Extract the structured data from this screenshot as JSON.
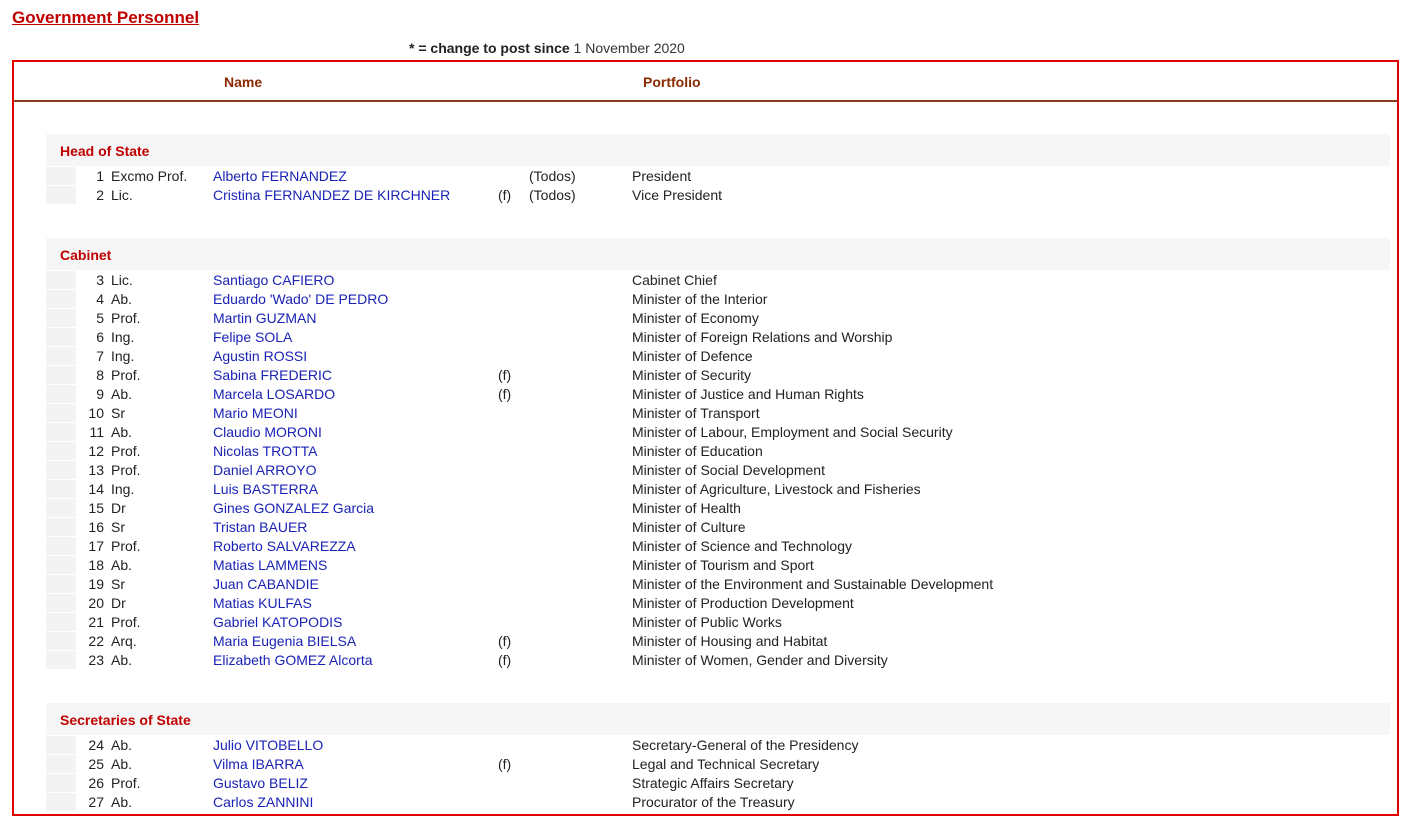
{
  "page": {
    "title": "Government Personnel",
    "legend_symbol": "* = change to post since",
    "legend_date": "1 November 2020"
  },
  "table": {
    "headers": {
      "name": "Name",
      "portfolio": "Portfolio"
    },
    "sections": [
      {
        "label": "Head of State",
        "rows": [
          {
            "num": "1",
            "title": "Excmo Prof.",
            "name": "Alberto FERNANDEZ",
            "female": "",
            "todos": "(Todos)",
            "post": "President"
          },
          {
            "num": "2",
            "title": "Lic.",
            "name": "Cristina FERNANDEZ DE KIRCHNER",
            "female": "(f)",
            "todos": "(Todos)",
            "post": "Vice President"
          }
        ]
      },
      {
        "label": "Cabinet",
        "rows": [
          {
            "num": "3",
            "title": "Lic.",
            "name": "Santiago CAFIERO",
            "female": "",
            "todos": "",
            "post": "Cabinet Chief"
          },
          {
            "num": "4",
            "title": "Ab.",
            "name": "Eduardo 'Wado' DE PEDRO",
            "female": "",
            "todos": "",
            "post": "Minister of the Interior"
          },
          {
            "num": "5",
            "title": "Prof.",
            "name": "Martin GUZMAN",
            "female": "",
            "todos": "",
            "post": "Minister of Economy"
          },
          {
            "num": "6",
            "title": "Ing.",
            "name": "Felipe SOLA",
            "female": "",
            "todos": "",
            "post": "Minister of Foreign Relations and Worship"
          },
          {
            "num": "7",
            "title": "Ing.",
            "name": "Agustin ROSSI",
            "female": "",
            "todos": "",
            "post": "Minister of Defence"
          },
          {
            "num": "8",
            "title": "Prof.",
            "name": "Sabina FREDERIC",
            "female": "(f)",
            "todos": "",
            "post": "Minister of Security"
          },
          {
            "num": "9",
            "title": "Ab.",
            "name": "Marcela LOSARDO",
            "female": "(f)",
            "todos": "",
            "post": "Minister of Justice and Human Rights"
          },
          {
            "num": "10",
            "title": "Sr",
            "name": "Mario MEONI",
            "female": "",
            "todos": "",
            "post": "Minister of Transport"
          },
          {
            "num": "11",
            "title": "Ab.",
            "name": "Claudio MORONI",
            "female": "",
            "todos": "",
            "post": "Minister of Labour, Employment and Social Security"
          },
          {
            "num": "12",
            "title": "Prof.",
            "name": "Nicolas TROTTA",
            "female": "",
            "todos": "",
            "post": "Minister of Education"
          },
          {
            "num": "13",
            "title": "Prof.",
            "name": "Daniel ARROYO",
            "female": "",
            "todos": "",
            "post": "Minister of Social Development"
          },
          {
            "num": "14",
            "title": "Ing.",
            "name": "Luis BASTERRA",
            "female": "",
            "todos": "",
            "post": "Minister of Agriculture, Livestock and Fisheries"
          },
          {
            "num": "15",
            "title": "Dr",
            "name": "Gines GONZALEZ Garcia",
            "female": "",
            "todos": "",
            "post": "Minister of Health"
          },
          {
            "num": "16",
            "title": "Sr",
            "name": "Tristan BAUER",
            "female": "",
            "todos": "",
            "post": "Minister of Culture"
          },
          {
            "num": "17",
            "title": "Prof.",
            "name": "Roberto SALVAREZZA",
            "female": "",
            "todos": "",
            "post": "Minister of Science and Technology"
          },
          {
            "num": "18",
            "title": "Ab.",
            "name": "Matias LAMMENS",
            "female": "",
            "todos": "",
            "post": "Minister of Tourism and Sport"
          },
          {
            "num": "19",
            "title": "Sr",
            "name": "Juan CABANDIE",
            "female": "",
            "todos": "",
            "post": "Minister of the Environment and Sustainable Development"
          },
          {
            "num": "20",
            "title": "Dr",
            "name": "Matias KULFAS",
            "female": "",
            "todos": "",
            "post": "Minister of Production Development"
          },
          {
            "num": "21",
            "title": "Prof.",
            "name": "Gabriel KATOPODIS",
            "female": "",
            "todos": "",
            "post": "Minister of Public Works"
          },
          {
            "num": "22",
            "title": "Arq.",
            "name": "Maria Eugenia BIELSA",
            "female": "(f)",
            "todos": "",
            "post": "Minister of Housing and Habitat"
          },
          {
            "num": "23",
            "title": "Ab.",
            "name": "Elizabeth GOMEZ Alcorta",
            "female": "(f)",
            "todos": "",
            "post": "Minister of Women, Gender and Diversity"
          }
        ]
      },
      {
        "label": "Secretaries of State",
        "rows": [
          {
            "num": "24",
            "title": "Ab.",
            "name": "Julio VITOBELLO",
            "female": "",
            "todos": "",
            "post": "Secretary-General of the Presidency"
          },
          {
            "num": "25",
            "title": "Ab.",
            "name": "Vilma IBARRA",
            "female": "(f)",
            "todos": "",
            "post": "Legal and Technical Secretary"
          },
          {
            "num": "26",
            "title": "Prof.",
            "name": "Gustavo BELIZ",
            "female": "",
            "todos": "",
            "post": "Strategic Affairs Secretary"
          },
          {
            "num": "27",
            "title": "Ab.",
            "name": "Carlos ZANNINI",
            "female": "",
            "todos": "",
            "post": "Procurator of the Treasury"
          }
        ]
      }
    ]
  }
}
